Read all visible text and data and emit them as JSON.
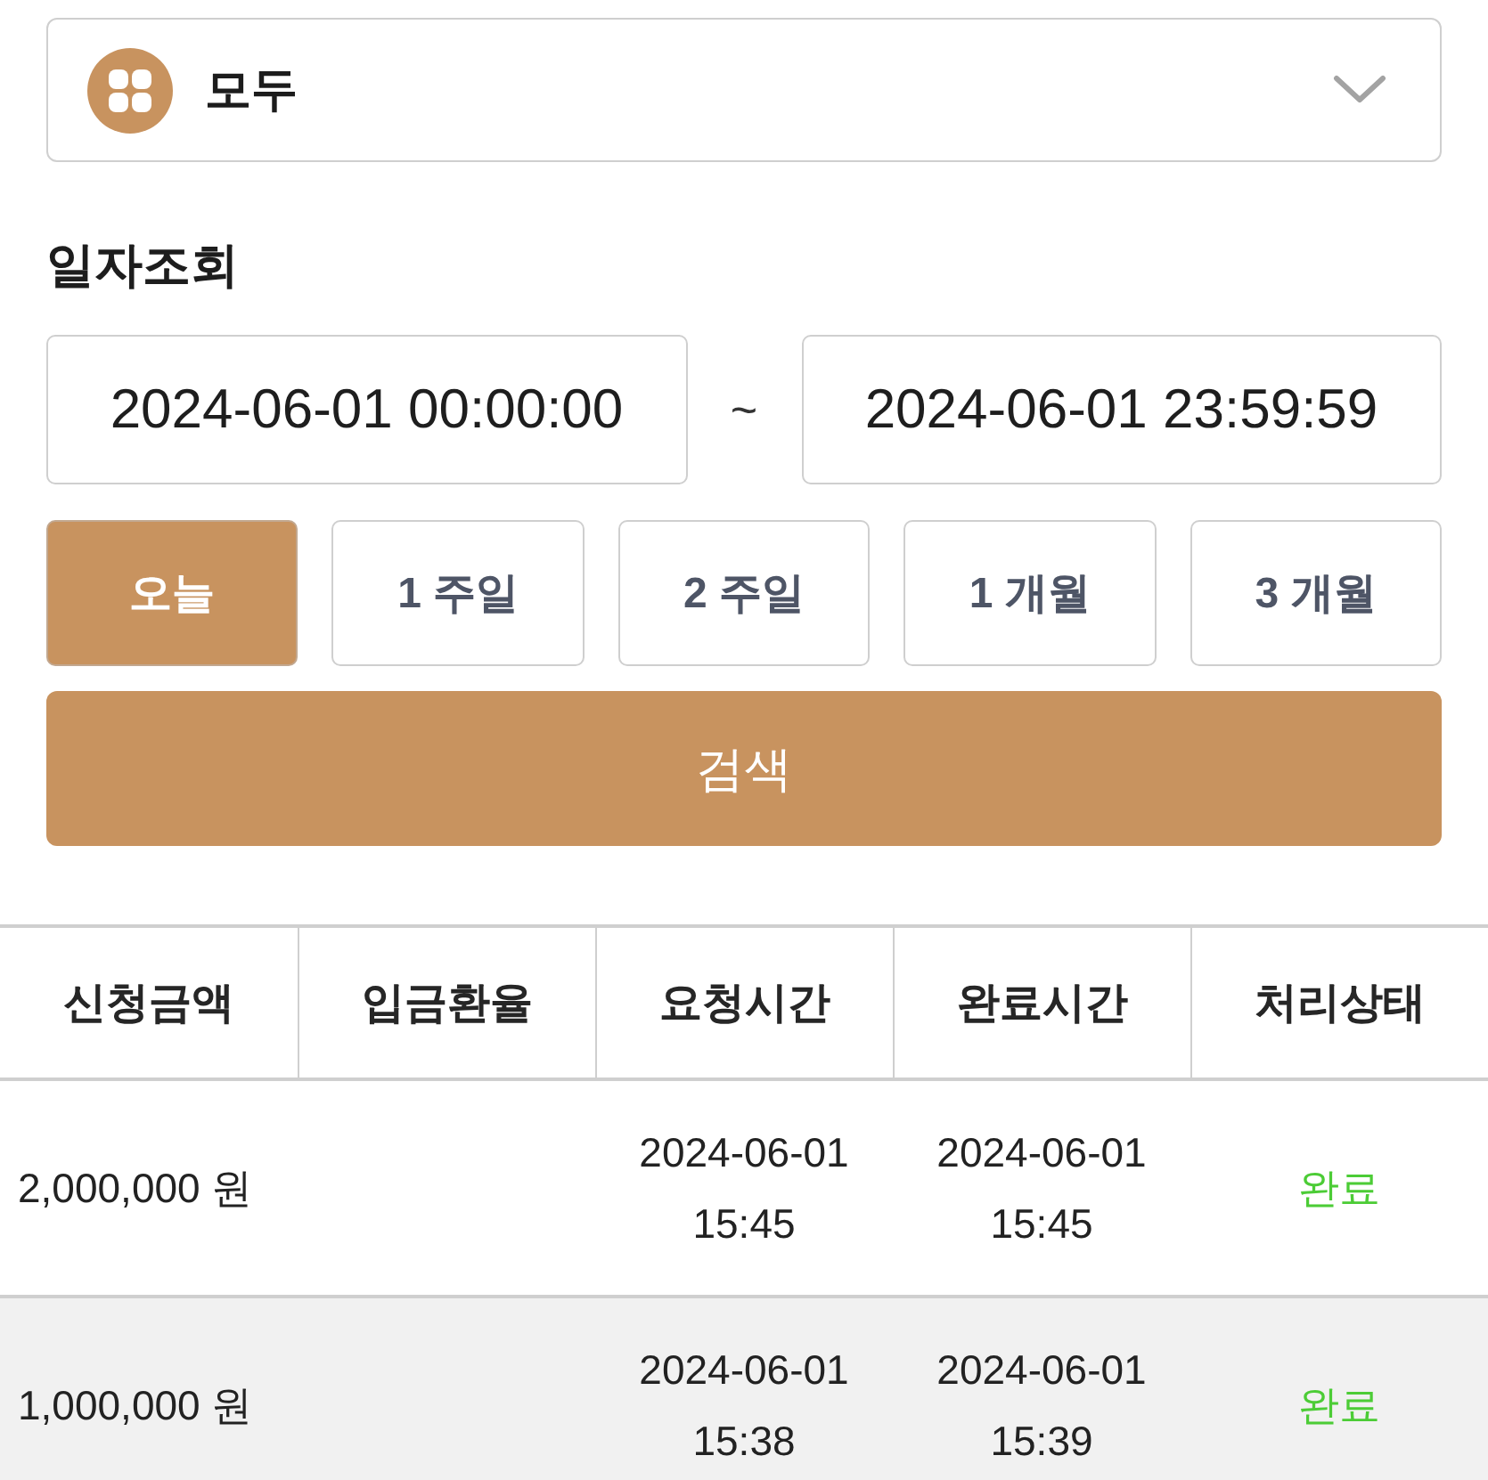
{
  "filter": {
    "value": "모두"
  },
  "date_search": {
    "title": "일자조회",
    "start": "2024-06-01 00:00:00",
    "separator": "~",
    "end": "2024-06-01 23:59:59"
  },
  "periods": [
    {
      "label": "오늘",
      "selected": true
    },
    {
      "label": "1 주일",
      "selected": false
    },
    {
      "label": "2 주일",
      "selected": false
    },
    {
      "label": "1 개월",
      "selected": false
    },
    {
      "label": "3 개월",
      "selected": false
    }
  ],
  "search_button": "검색",
  "table": {
    "columns": [
      "신청금액",
      "입금환율",
      "요청시간",
      "완료시간",
      "처리상태"
    ],
    "rows": [
      {
        "amount": "2,000,000 원",
        "requested": "2024-06-01 15:45",
        "completed": "2024-06-01 15:45",
        "status": "완료"
      },
      {
        "amount": "1,000,000 원",
        "requested": "2024-06-01 15:38",
        "completed": "2024-06-01 15:39",
        "status": "완료"
      }
    ]
  }
}
